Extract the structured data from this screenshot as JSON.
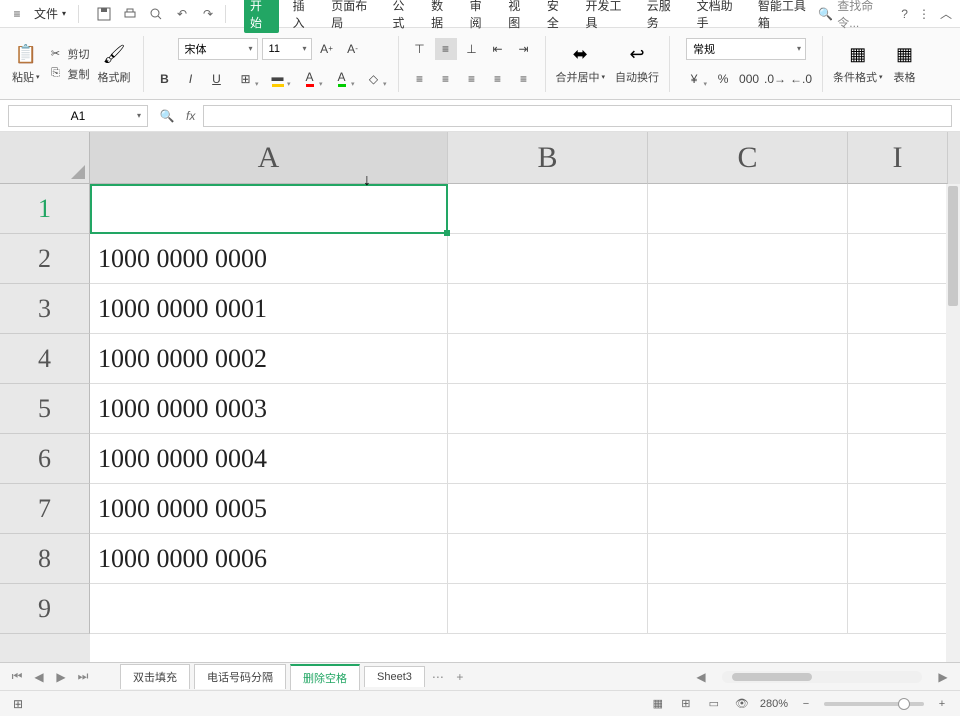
{
  "menu": {
    "file": "文件",
    "tabs": [
      "开始",
      "插入",
      "页面布局",
      "公式",
      "数据",
      "审阅",
      "视图",
      "安全",
      "开发工具",
      "云服务",
      "文档助手",
      "智能工具箱"
    ],
    "search": "查找命令..."
  },
  "ribbon": {
    "paste": "粘贴",
    "cut": "剪切",
    "copy": "复制",
    "format_painter": "格式刷",
    "font_name": "宋体",
    "font_size": "11",
    "merge_center": "合并居中",
    "auto_wrap": "自动换行",
    "number_format": "常规",
    "cond_format": "条件格式",
    "table_style": "表格"
  },
  "namebox": "A1",
  "columns": [
    "A",
    "B",
    "C",
    "I"
  ],
  "rows": [
    "1",
    "2",
    "3",
    "4",
    "5",
    "6",
    "7",
    "8",
    "9"
  ],
  "cells": {
    "a2": "1000  0000  0000",
    "a3": "1000  0000  0001",
    "a4": "1000  0000  0002",
    "a5": "1000  0000  0003",
    "a6": "1000  0000  0004",
    "a7": "1000  0000  0005",
    "a8": "1000  0000  0006"
  },
  "sheets": {
    "tab1": "双击填充",
    "tab2": "电话号码分隔",
    "tab3": "删除空格",
    "tab4": "Sheet3"
  },
  "status": {
    "zoom": "280%"
  }
}
